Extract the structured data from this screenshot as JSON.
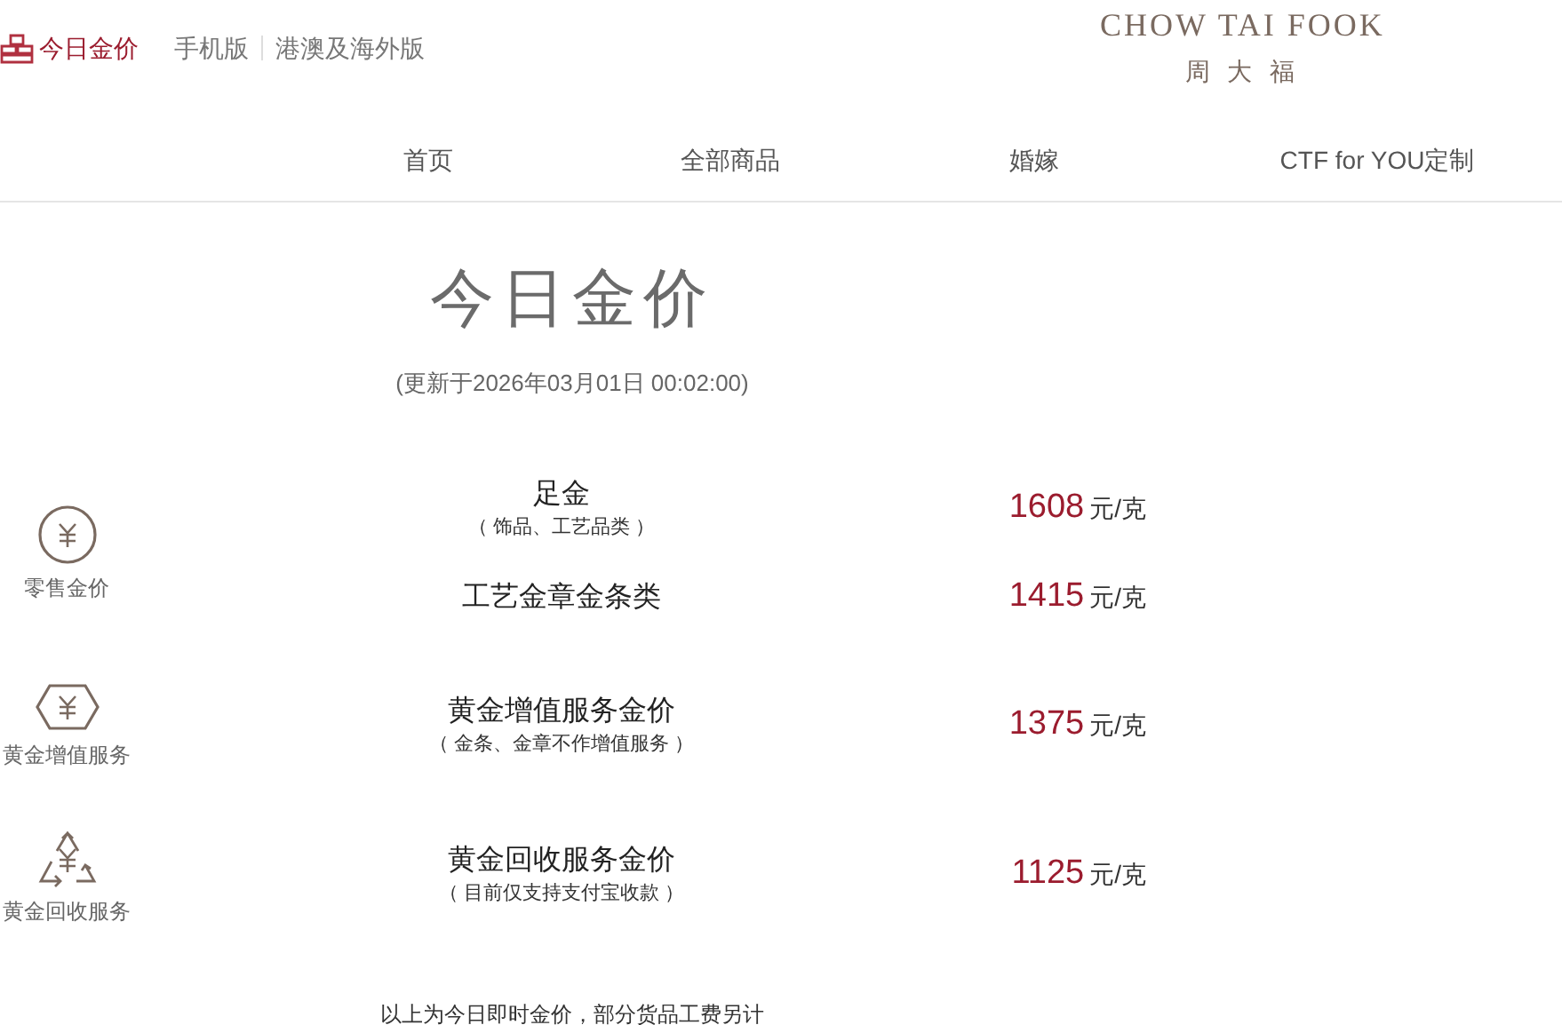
{
  "header": {
    "gold_price_link": "今日金价",
    "links": [
      "手机版",
      "港澳及海外版"
    ],
    "logo": {
      "name_en": "CHOW TAI FOOK",
      "name_zh": "周 大 福"
    }
  },
  "nav": [
    "首页",
    "全部商品",
    "婚嫁",
    "CTF for YOU定制"
  ],
  "title": "今日金价",
  "updated": "(更新于2026年03月01日 00:02:00)",
  "groups": [
    {
      "kind": "retail",
      "label": "零售金价",
      "items": [
        {
          "name": "足金",
          "note": "（ 饰品、工艺品类 ）",
          "price": "1608",
          "unit": "元/克"
        },
        {
          "name": "工艺金章金条类",
          "price": "1415",
          "unit": "元/克"
        }
      ]
    },
    {
      "kind": "value_added",
      "label": "黄金增值服务",
      "items": [
        {
          "name": "黄金增值服务金价",
          "note": "（ 金条、金章不作增值服务 ）",
          "price": "1375",
          "unit": "元/克"
        }
      ]
    },
    {
      "kind": "recycle",
      "label": "黄金回收服务",
      "items": [
        {
          "name": "黄金回收服务金价",
          "note": "（ 目前仅支持支付宝收款 ）",
          "price": "1125",
          "unit": "元/克"
        }
      ]
    }
  ],
  "footer_note": "以上为今日即时金价，部分货品工费另计"
}
